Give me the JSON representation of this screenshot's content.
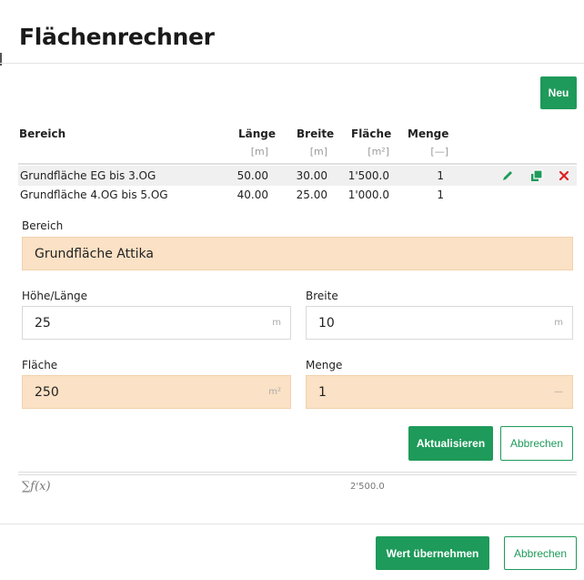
{
  "title": "Flächenrechner",
  "buttons": {
    "new": "Neu",
    "update": "Aktualisieren",
    "cancel_edit": "Abbrechen",
    "apply": "Wert übernehmen",
    "cancel": "Abbrechen"
  },
  "table": {
    "headers": [
      "Bereich",
      "Länge",
      "Breite",
      "Fläche",
      "Menge"
    ],
    "units": [
      "[m]",
      "[m]",
      "[m²]",
      "[—]"
    ],
    "rows": [
      {
        "bereich": "Grundfläche EG bis 3.OG",
        "laenge": "50.00",
        "breite": "30.00",
        "flaeche": "1'500.0",
        "menge": "1",
        "selected": true
      },
      {
        "bereich": "Grundfläche 4.OG bis 5.OG",
        "laenge": "40.00",
        "breite": "25.00",
        "flaeche": "1'000.0",
        "menge": "1",
        "selected": false
      }
    ],
    "row_actions": [
      "pencil-icon",
      "copy-icon",
      "delete-icon"
    ]
  },
  "form": {
    "bereich": {
      "label": "Bereich",
      "value": "Grundfläche Attika"
    },
    "hoehe": {
      "label": "Höhe/Länge",
      "value": "25",
      "unit": "m"
    },
    "breite": {
      "label": "Breite",
      "value": "10",
      "unit": "m"
    },
    "flaeche": {
      "label": "Fläche",
      "value": "250",
      "unit": "m²"
    },
    "menge": {
      "label": "Menge",
      "value": "1",
      "unit": "—"
    }
  },
  "sum": {
    "symbol": "∑f(x)",
    "value": "2'500.0"
  },
  "colors": {
    "accent": "#1e9a5a",
    "highlight_field": "#fbe1c5",
    "delete": "#e02020"
  }
}
